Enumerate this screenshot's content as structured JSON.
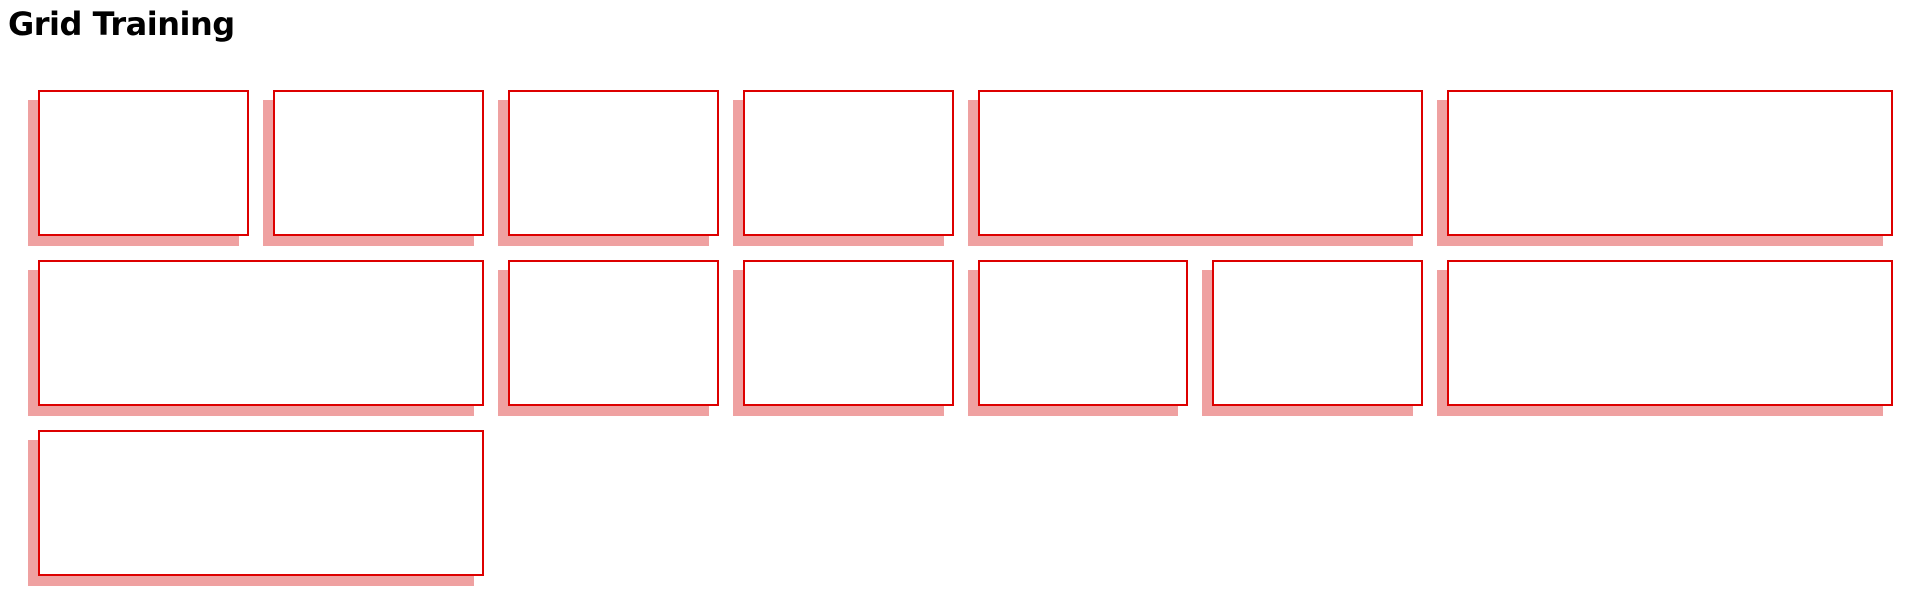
{
  "page": {
    "title": "Grid Training"
  },
  "colors": {
    "cell_border": "#dd0000",
    "cell_shadow": "#efa1a1",
    "cell_fill": "#ffffff",
    "background": "#ffffff"
  },
  "grid": {
    "columns": 8,
    "rows": [
      {
        "cells": [
          {
            "span": 1
          },
          {
            "span": 1
          },
          {
            "span": 1
          },
          {
            "span": 1
          },
          {
            "span": 2
          }
        ]
      },
      {
        "cells": [
          {
            "span": 2
          },
          {
            "span": 2
          },
          {
            "span": 1
          },
          {
            "span": 1
          }
        ]
      },
      {
        "cells": [
          {
            "span": 1
          },
          {
            "span": 1
          },
          {
            "span": 2
          },
          {
            "span": 2
          }
        ]
      }
    ]
  }
}
